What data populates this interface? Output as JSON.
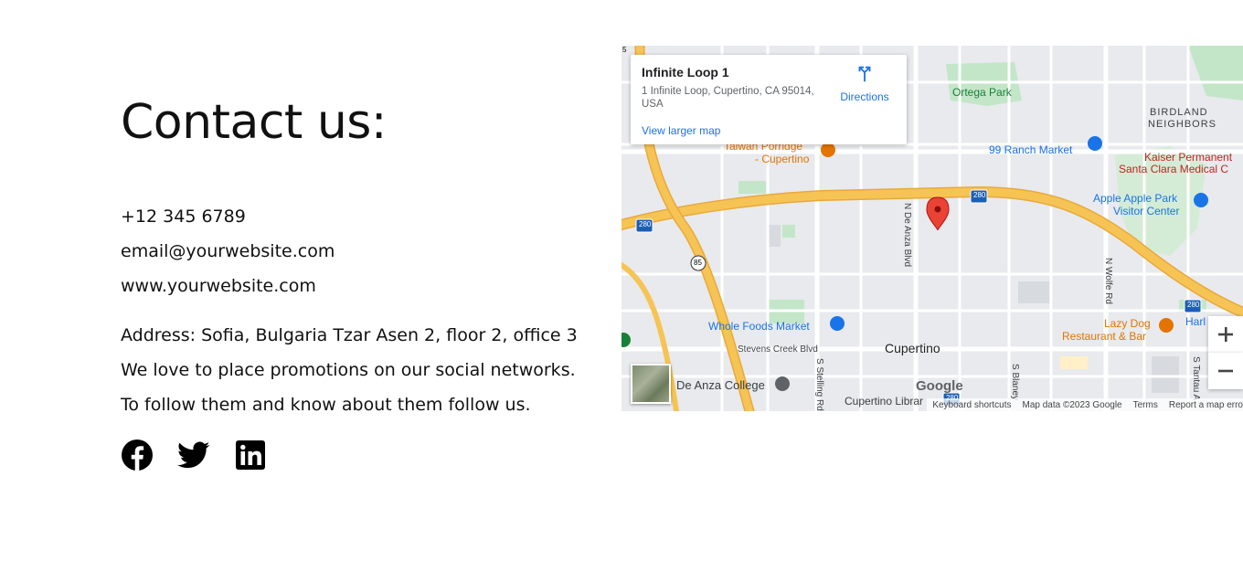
{
  "contact": {
    "title": "Contact us:",
    "phone": "+12 345 6789",
    "email": "email@yourwebsite.com",
    "website": "www.yourwebsite.com",
    "address": "Address: Sofia, Bulgaria Tzar Asen 2, floor 2, office 3",
    "promo_line1": "We love to place promotions on our social networks.",
    "promo_line2": "To follow them and know about them follow us."
  },
  "social": [
    {
      "name": "facebook-icon"
    },
    {
      "name": "twitter-icon"
    },
    {
      "name": "linkedin-icon"
    }
  ],
  "map": {
    "card": {
      "title": "Infinite Loop 1",
      "address": "1 Infinite Loop, Cupertino, CA 95014, USA",
      "directions": "Directions",
      "larger_map": "View larger map"
    },
    "labels": {
      "ortega_park": "Ortega Park",
      "birdland": "BIRDLAND",
      "neighbors": "NEIGHBORS",
      "ranch_market": "99 Ranch Market",
      "kaiser1": "Kaiser Permanent",
      "kaiser2": "Santa Clara Medical C",
      "taiwan1": "Taiwan Porridge",
      "taiwan2": "- Cupertino",
      "apple_park1": "Apple Apple Park",
      "apple_park2": "Visitor Center",
      "whole_foods": "Whole Foods Market",
      "lazy_dog1": "Lazy Dog",
      "lazy_dog2": "Restaurant & Bar",
      "harl": "Harl",
      "cupertino": "Cupertino",
      "stevens_creek": "Stevens Creek Blvd",
      "de_anza_college": "De Anza College",
      "cupertino_library": "Cupertino Librar",
      "n_de_anza": "N De Anza Blvd",
      "n_wolfe": "N Wolfe Rd",
      "s_stelling": "S Stelling Rd",
      "s_blaney": "S Blaney",
      "s_tantau": "S Tantau A",
      "shield_280a": "280",
      "shield_280b": "280",
      "shield_280c": "280",
      "shield_280d": "280",
      "shield_85": "85",
      "shield_5": "5",
      "google": "Google"
    },
    "footer": {
      "shortcuts": "Keyboard shortcuts",
      "data": "Map data ©2023 Google",
      "terms": "Terms",
      "report": "Report a map erro"
    },
    "colors": {
      "highway": "#f6c455",
      "highway_edge": "#e8a93b",
      "park": "#c3e6c8",
      "road": "#ffffff",
      "pin": "#ea4335",
      "link": "#1a73e8",
      "poi_blue": "#1a73e8",
      "poi_orange": "#e37400",
      "poi_green": "#188038"
    }
  }
}
